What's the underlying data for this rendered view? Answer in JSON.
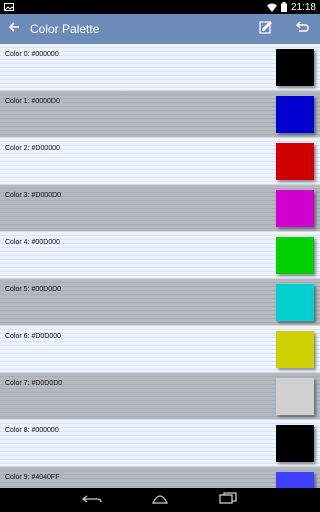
{
  "status": {
    "time": "21:18"
  },
  "action_bar": {
    "title": "Color Palette"
  },
  "colors": [
    {
      "label": "Color 0: #000000",
      "hex": "#000000"
    },
    {
      "label": "Color 1: #0000D0",
      "hex": "#0000D0"
    },
    {
      "label": "Color 2: #D00000",
      "hex": "#D00000"
    },
    {
      "label": "Color 3: #D000D0",
      "hex": "#D000D0"
    },
    {
      "label": "Color 4: #00D000",
      "hex": "#00D000"
    },
    {
      "label": "Color 5: #00D0D0",
      "hex": "#00D0D0"
    },
    {
      "label": "Color 6: #D0D000",
      "hex": "#D0D000"
    },
    {
      "label": "Color 7: #D0D0D0",
      "hex": "#D0D0D0"
    },
    {
      "label": "Color 8: #000000",
      "hex": "#000000"
    },
    {
      "label": "Color 9: #4040FF",
      "hex": "#4040FF"
    }
  ],
  "theme": {
    "action_bar": "#6d8bb8",
    "row_light": "#eef4ff",
    "row_dark": "#b4b9c0"
  }
}
